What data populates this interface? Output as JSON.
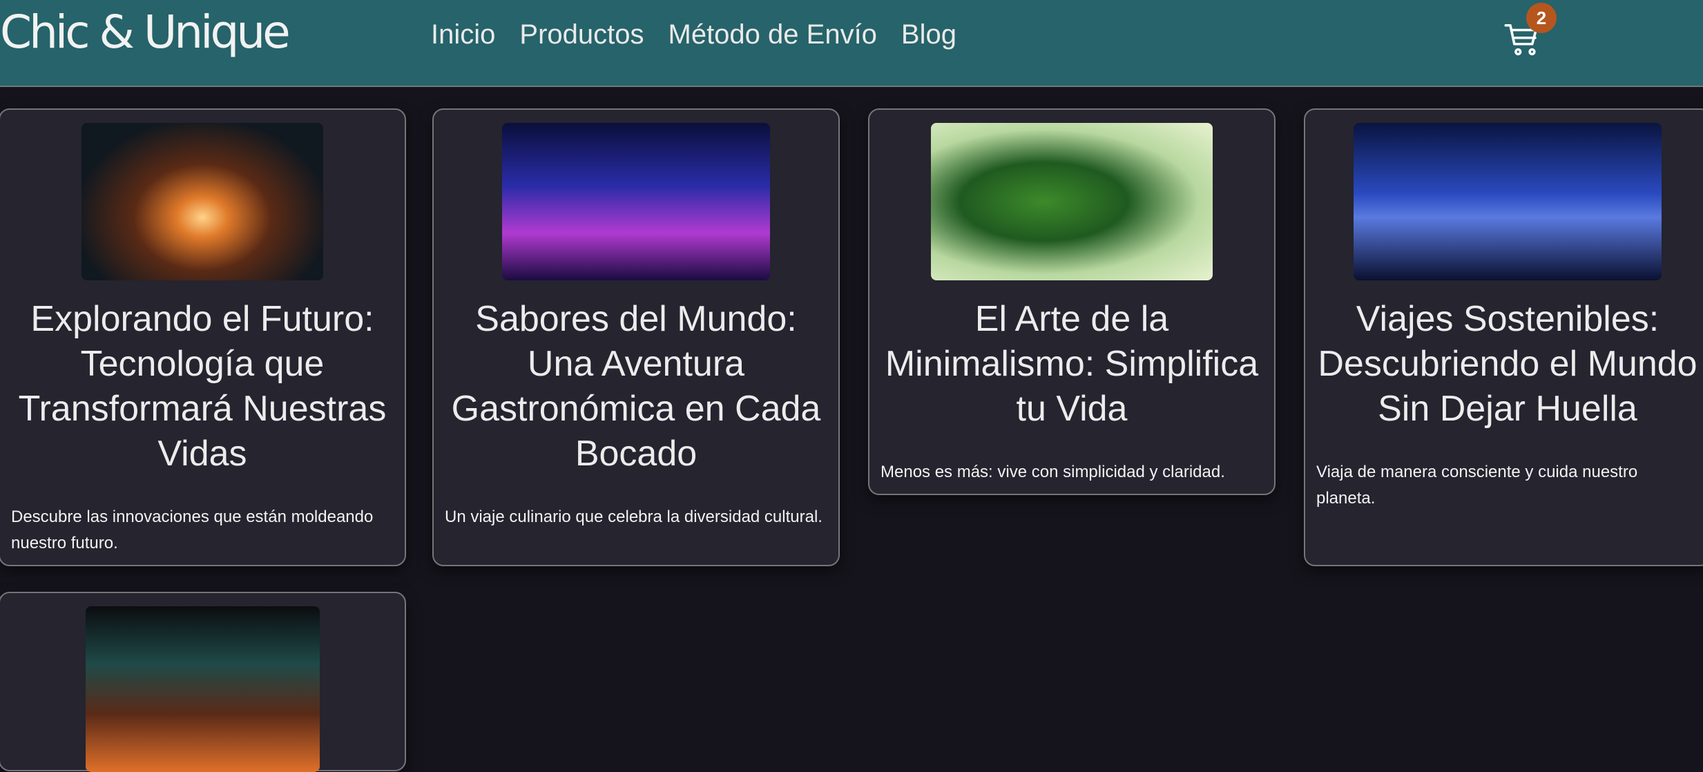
{
  "header": {
    "logo": "Chic & Unique",
    "nav": [
      "Inicio",
      "Productos",
      "Método de Envío",
      "Blog"
    ],
    "cart_count": "2"
  },
  "posts": [
    {
      "title": "Explorando el Futuro: Tecnología que Transformará Nuestras Vidas",
      "description": "Descubre las innovaciones que están moldeando nuestro futuro."
    },
    {
      "title": "Sabores del Mundo: Una Aventura Gastronómica en Cada Bocado",
      "description": "Un viaje culinario que celebra la diversidad cultural."
    },
    {
      "title": "El Arte de la Minimalismo: Simplifica tu Vida",
      "description": "Menos es más: vive con simplicidad y claridad."
    },
    {
      "title": "Viajes Sostenibles: Descubriendo el Mundo Sin Dejar Huella",
      "description": "Viaja de manera consciente y cuida nuestro planeta."
    }
  ]
}
